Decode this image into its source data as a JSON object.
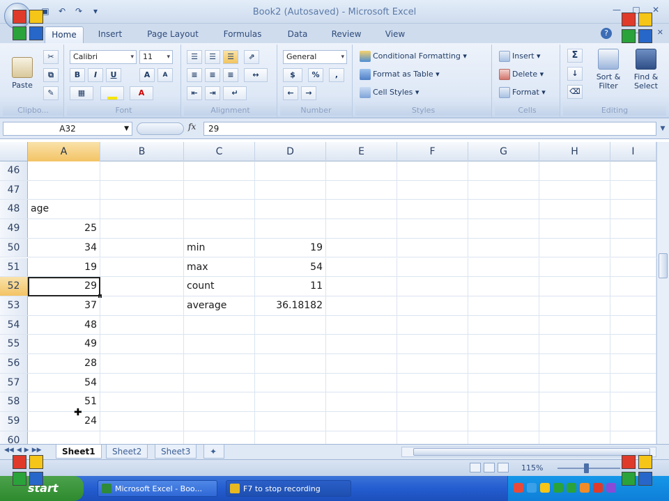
{
  "window": {
    "title": "Book2 (Autosaved) - Microsoft Excel"
  },
  "tabs": [
    "Home",
    "Insert",
    "Page Layout",
    "Formulas",
    "Data",
    "Review",
    "View"
  ],
  "ribbon": {
    "clipboard": {
      "label": "Clipbo...",
      "paste": "Paste"
    },
    "font": {
      "label": "Font",
      "name": "Calibri",
      "size": "11",
      "bold": "B",
      "italic": "I",
      "underline": "U",
      "grow": "A",
      "shrink": "A"
    },
    "alignment": {
      "label": "Alignment"
    },
    "number": {
      "label": "Number",
      "format": "General",
      "currency": "$",
      "percent": "%",
      "comma": ","
    },
    "styles": {
      "label": "Styles",
      "conditional": "Conditional Formatting",
      "format_table": "Format as Table",
      "cell_styles": "Cell Styles"
    },
    "cells": {
      "label": "Cells",
      "insert": "Insert",
      "delete": "Delete",
      "format": "Format"
    },
    "editing": {
      "label": "Editing",
      "sigma": "Σ",
      "sort": "Sort & Filter",
      "find": "Find & Select"
    }
  },
  "formula_bar": {
    "name_box": "A32",
    "fx": "fx",
    "value": "29"
  },
  "columns": [
    "A",
    "B",
    "C",
    "D",
    "E",
    "F",
    "G",
    "H",
    "I"
  ],
  "selected_column": "A",
  "rows": [
    {
      "n": "46",
      "a": "",
      "c": "",
      "d": ""
    },
    {
      "n": "47",
      "a": "",
      "c": "",
      "d": ""
    },
    {
      "n": "48",
      "a": "age",
      "c": "",
      "d": ""
    },
    {
      "n": "49",
      "a": "25",
      "c": "",
      "d": ""
    },
    {
      "n": "50",
      "a": "34",
      "c": "min",
      "d": "19"
    },
    {
      "n": "51",
      "a": "19",
      "c": "max",
      "d": "54"
    },
    {
      "n": "52",
      "a": "29",
      "c": "count",
      "d": "11"
    },
    {
      "n": "53",
      "a": "37",
      "c": "average",
      "d": "36.18182"
    },
    {
      "n": "54",
      "a": "48",
      "c": "",
      "d": ""
    },
    {
      "n": "55",
      "a": "49",
      "c": "",
      "d": ""
    },
    {
      "n": "56",
      "a": "28",
      "c": "",
      "d": ""
    },
    {
      "n": "57",
      "a": "54",
      "c": "",
      "d": ""
    },
    {
      "n": "58",
      "a": "51",
      "c": "",
      "d": ""
    },
    {
      "n": "59",
      "a": "24",
      "c": "",
      "d": ""
    },
    {
      "n": "60",
      "a": "",
      "c": "",
      "d": ""
    }
  ],
  "selected_row": "52",
  "sheets": [
    "Sheet1",
    "Sheet2",
    "Sheet3"
  ],
  "active_sheet": "Sheet1",
  "status": {
    "zoom": "115%"
  },
  "taskbar": {
    "start": "start",
    "items": [
      "Microsoft Excel - Boo...",
      "F7 to stop recording"
    ]
  },
  "colors": {
    "ribbon": "#dee8f6",
    "selection_header": "#f3c365",
    "taskbar": "#245dd0"
  }
}
